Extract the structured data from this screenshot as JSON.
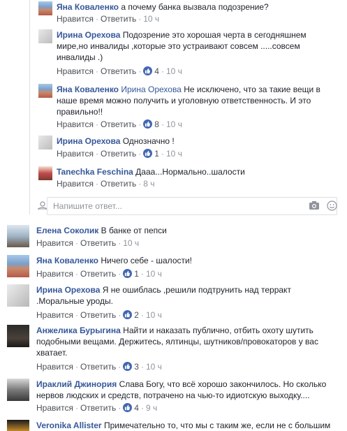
{
  "reply_box": {
    "placeholder": "Напишите ответ..."
  },
  "replies": [
    {
      "author": "Яна Коваленко",
      "text": "а почему банка вызвала подозрение?",
      "like": "Нравится",
      "reply": "Ответить",
      "time": "10 ч",
      "likes": ""
    },
    {
      "author": "Ирина Орехова",
      "text": "Подозрение это хорошая черта в сегодняшнем миpe,но инвалиды ,которые это устраивают совсем .....совсем инвалиды .)",
      "like": "Нравится",
      "reply": "Ответить",
      "time": "10 ч",
      "likes": "4"
    },
    {
      "author": "Яна Коваленко",
      "mention": "Ирина Орехова",
      "text": "Не исключено, что за такие вещи в наше время можно получить и уголовную ответственность. И это правильно!!",
      "like": "Нравится",
      "reply": "Ответить",
      "time": "10 ч",
      "likes": "8"
    },
    {
      "author": "Ирина Орехова",
      "text": "Однозначно !",
      "like": "Нравится",
      "reply": "Ответить",
      "time": "10 ч",
      "likes": "1"
    },
    {
      "author": "Tanechka Feschina",
      "text": "Дааа...Нормально..шалости",
      "like": "Нравится",
      "reply": "Ответить",
      "time": "8 ч",
      "likes": ""
    }
  ],
  "comments": [
    {
      "author": "Елена Соколик",
      "text": "В банке от пепси",
      "like": "Нравится",
      "reply": "Ответить",
      "time": "10 ч",
      "likes": ""
    },
    {
      "author": "Яна Коваленко",
      "text": "Ничего себе - шалости!",
      "like": "Нравится",
      "reply": "Ответить",
      "time": "10 ч",
      "likes": "1"
    },
    {
      "author": "Ирина Орехова",
      "text": "Я не ошиблась ,решили подтрунить над терракт .Моральные уроды.",
      "like": "Нравится",
      "reply": "Ответить",
      "time": "10 ч",
      "likes": "2"
    },
    {
      "author": "Анжелика Бурыгина",
      "text": "Найти и наказать публично, отбить охоту шутить подобными вещами. Держитесь, ялтинцы, шутников/провокаторов у вас хватает.",
      "like": "Нравится",
      "reply": "Ответить",
      "time": "10 ч",
      "likes": "3"
    },
    {
      "author": "Ираклий Джинория",
      "text": "Слава Богу, что всё хорошо закончилось. Но сколько нервов людских и средств, потрачено на чью-то идиотскую выходку....",
      "like": "Нравится",
      "reply": "Ответить",
      "time": "9 ч",
      "likes": "4"
    },
    {
      "author": "Veronika Allister",
      "text": "Примечательно то, что мы с таким же, если не с большим",
      "like": "",
      "reply": "",
      "time": "",
      "likes": ""
    }
  ],
  "colors": {
    "author": "#365899",
    "like_badge": "#4267b2",
    "meta": "#90949c"
  }
}
